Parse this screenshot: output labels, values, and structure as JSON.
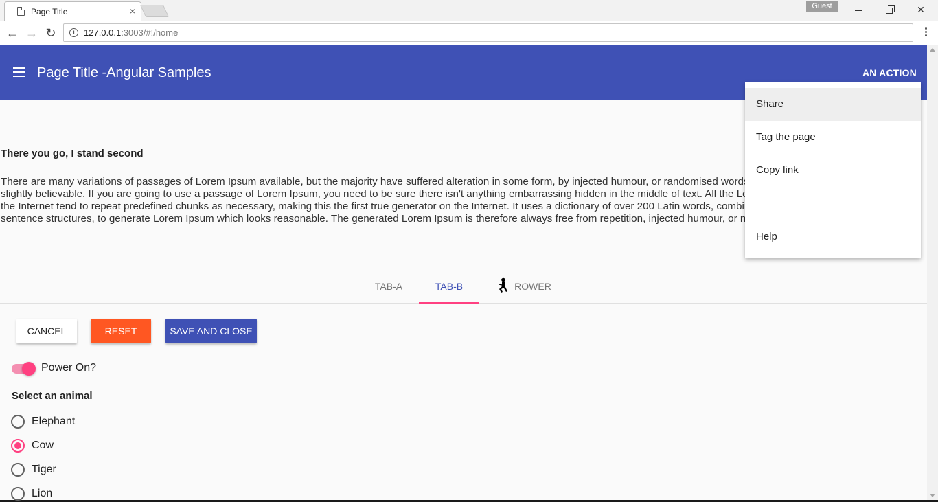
{
  "browser": {
    "tab_title": "Page Title",
    "tab_close": "×",
    "profile": "Guest",
    "url_host": "127.0.0.1",
    "url_rest": ":3003/#!/home",
    "back": "←",
    "forward": "→",
    "reload": "↻",
    "info": "i",
    "win_close": "✕"
  },
  "app": {
    "title": "Page Title -Angular Samples",
    "action": "AN ACTION"
  },
  "content": {
    "heading": "There you go, I stand second",
    "para_lines": [
      "There are many variations of passages of Lorem Ipsum available, but the majority have suffered alteration in some form, by injected humour, or randomised words which don't look even",
      "slightly believable. If you are going to use a passage of Lorem Ipsum, you need to be sure there isn't anything embarrassing hidden in the middle of text. All the Lorem Ipsum generators on",
      "the Internet tend to repeat predefined chunks as necessary, making this the first true generator on the Internet. It uses a dictionary of over 200 Latin words, combined with a handful of model",
      "sentence structures, to generate Lorem Ipsum which looks reasonable. The generated Lorem Ipsum is therefore always free from repetition, injected humour, or non-characteristic words etc."
    ]
  },
  "tabs": [
    {
      "label": "TAB-A"
    },
    {
      "label": "TAB-B",
      "active": true
    },
    {
      "label": "ROWER",
      "icon": "rower-icon"
    }
  ],
  "buttons": {
    "cancel": "CANCEL",
    "reset": "RESET",
    "save": "SAVE AND CLOSE"
  },
  "toggle": {
    "label": "Power On?",
    "on": true
  },
  "radio_group": {
    "heading": "Select an animal",
    "options": [
      "Elephant",
      "Cow",
      "Tiger",
      "Lion"
    ],
    "selected": "Cow"
  },
  "menu": {
    "items": [
      "Share",
      "Tag the page",
      "Copy link",
      "Help"
    ]
  },
  "colors": {
    "primary": "#3f51b5",
    "accent": "#ff4081",
    "warn": "#ff5722"
  }
}
